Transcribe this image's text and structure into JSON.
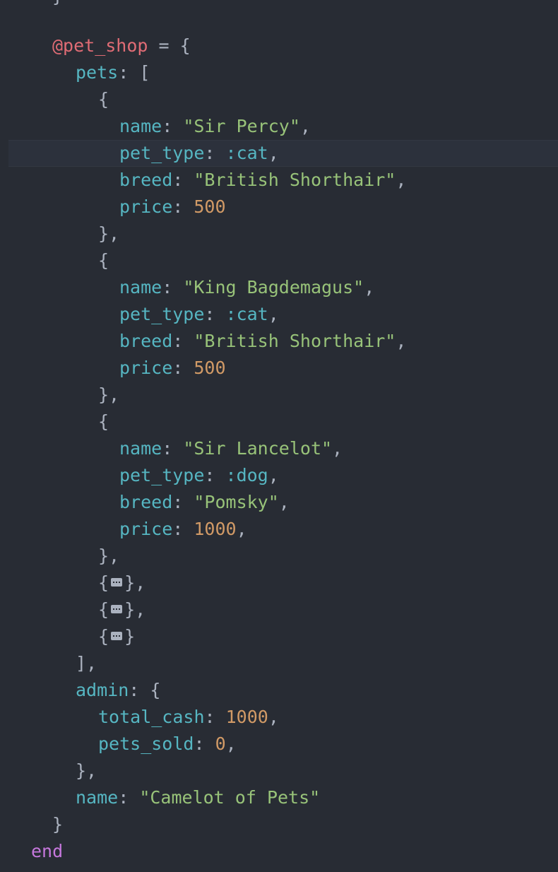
{
  "editor": {
    "colors": {
      "background": "#282c34",
      "ivar": "#e06c75",
      "key": "#56b6c2",
      "string": "#98c379",
      "number": "#d19a66",
      "keyword": "#c678dd",
      "punctuation": "#abb2bf"
    },
    "top_fragment": "}",
    "ivar": "@pet_shop",
    "assign": " = {",
    "pets_key": "pets",
    "pets_open": ": [",
    "pets": [
      {
        "name_key": "name",
        "name": "\"Sir Percy\"",
        "pet_type_key": "pet_type",
        "pet_type": ":cat",
        "breed_key": "breed",
        "breed": "\"British Shorthair\"",
        "price_key": "price",
        "price": "500",
        "price_trail": "",
        "close": "},"
      },
      {
        "name_key": "name",
        "name": "\"King Bagdemagus\"",
        "pet_type_key": "pet_type",
        "pet_type": ":cat",
        "breed_key": "breed",
        "breed": "\"British Shorthair\"",
        "price_key": "price",
        "price": "500",
        "price_trail": "",
        "close": "},"
      },
      {
        "name_key": "name",
        "name": "\"Sir Lancelot\"",
        "pet_type_key": "pet_type",
        "pet_type": ":dog",
        "breed_key": "breed",
        "breed": "\"Pomsky\"",
        "price_key": "price",
        "price": "1000",
        "price_trail": ",",
        "close": "},"
      }
    ],
    "folded": [
      {
        "open": "{",
        "close": "},"
      },
      {
        "open": "{",
        "close": "},"
      },
      {
        "open": "{",
        "close": "}"
      }
    ],
    "pets_close": "],",
    "admin_key": "admin",
    "admin_open": ": {",
    "total_cash_key": "total_cash",
    "total_cash": "1000",
    "pets_sold_key": "pets_sold",
    "pets_sold": "0",
    "admin_close": "},",
    "shop_name_key": "name",
    "shop_name": "\"Camelot of Pets\"",
    "hash_close": "}",
    "end_keyword": "end"
  }
}
